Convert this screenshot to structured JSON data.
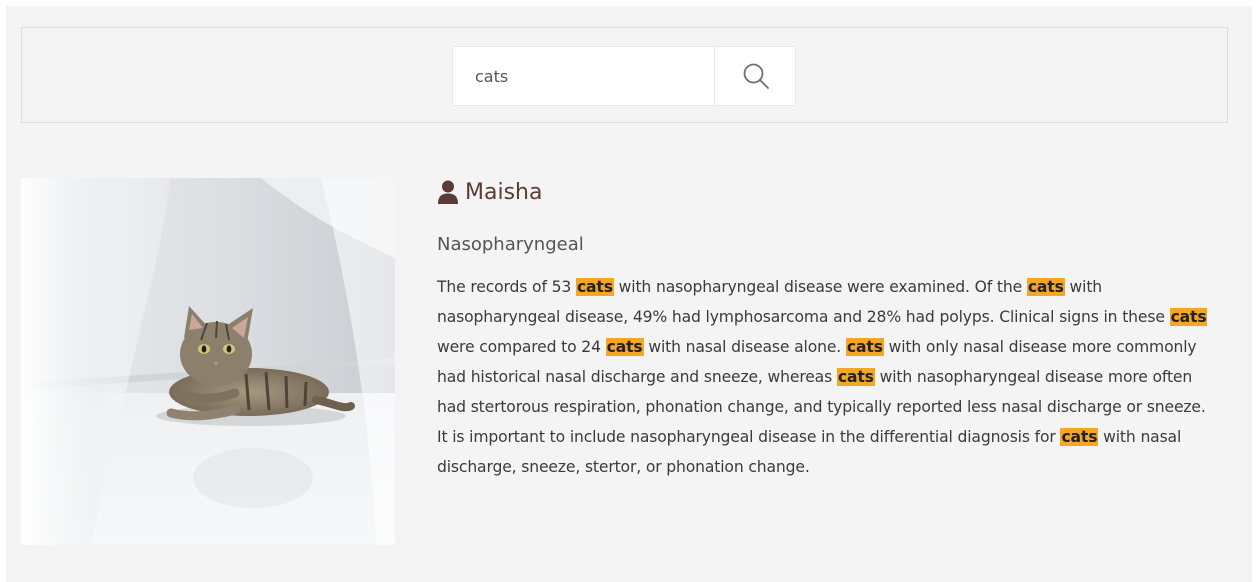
{
  "search": {
    "value": "cats",
    "button_icon": "search-icon"
  },
  "result": {
    "image_icon": "cat-photo",
    "author_icon": "user-icon",
    "author": "Maisha",
    "title": "Nasopharyngeal",
    "highlight_term": "cats",
    "highlight_color": "#f5a623",
    "author_color": "#5c3a36",
    "body_segments": [
      {
        "t": "The records of 53 "
      },
      {
        "t": "cats",
        "hl": true
      },
      {
        "t": " with nasopharyngeal disease were examined. Of the "
      },
      {
        "t": "cats",
        "hl": true
      },
      {
        "t": " with nasopharyngeal disease, 49% had lymphosarcoma and 28% had polyps. Clinical signs in these "
      },
      {
        "t": "cats",
        "hl": true
      },
      {
        "t": " were compared to 24 "
      },
      {
        "t": "cats",
        "hl": true
      },
      {
        "t": " with nasal disease alone. "
      },
      {
        "t": "cats",
        "hl": true
      },
      {
        "t": " with only nasal disease more commonly had historical nasal discharge and sneeze, whereas "
      },
      {
        "t": "cats",
        "hl": true
      },
      {
        "t": " with nasopharyngeal disease more often had stertorous respiration, phonation change, and typically reported less nasal discharge or sneeze. It is important to include nasopharyngeal disease in the differential diagnosis for "
      },
      {
        "t": "cats",
        "hl": true
      },
      {
        "t": " with nasal discharge, sneeze, stertor, or phonation change."
      }
    ]
  }
}
